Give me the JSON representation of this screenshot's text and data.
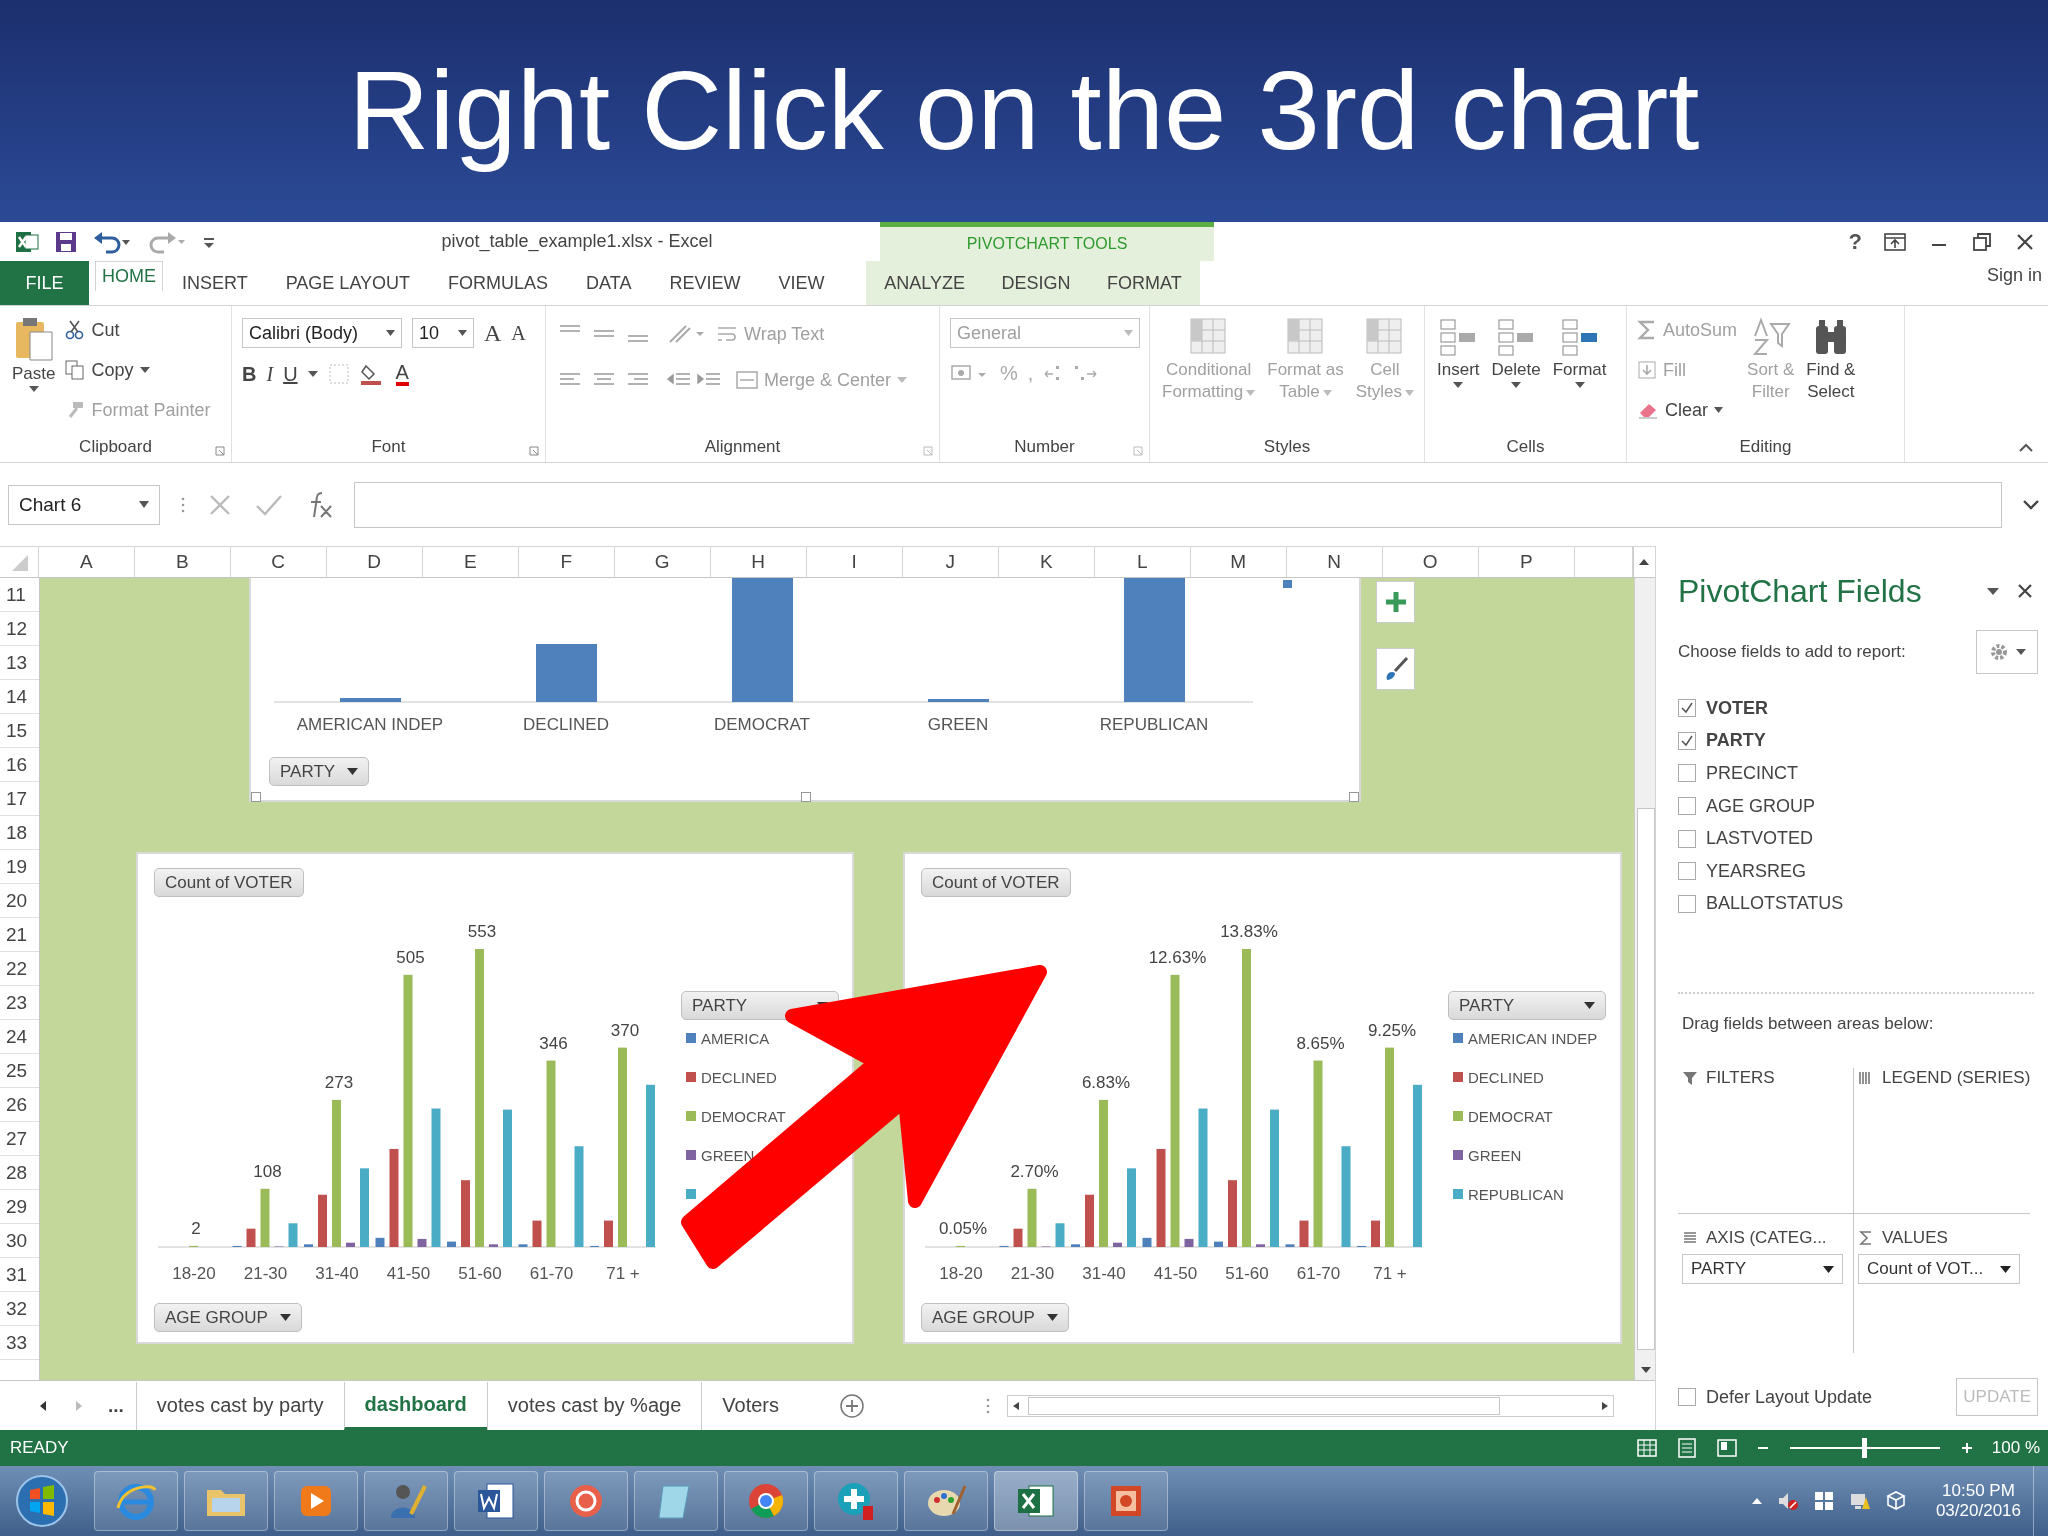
{
  "slide": {
    "title": "Right Click on the 3rd chart"
  },
  "window": {
    "title": "pivot_table_example1.xlsx - Excel",
    "context_group": "PIVOTCHART TOOLS",
    "help": "?"
  },
  "tabs": [
    {
      "label": "FILE",
      "kind": "file",
      "selected": false
    },
    {
      "label": "HOME",
      "kind": "main",
      "selected": true
    },
    {
      "label": "INSERT",
      "kind": "main",
      "selected": false
    },
    {
      "label": "PAGE LAYOUT",
      "kind": "main",
      "selected": false
    },
    {
      "label": "FORMULAS",
      "kind": "main",
      "selected": false
    },
    {
      "label": "DATA",
      "kind": "main",
      "selected": false
    },
    {
      "label": "REVIEW",
      "kind": "main",
      "selected": false
    },
    {
      "label": "VIEW",
      "kind": "main",
      "selected": false
    },
    {
      "label": "ANALYZE",
      "kind": "context",
      "selected": false
    },
    {
      "label": "DESIGN",
      "kind": "context",
      "selected": false
    },
    {
      "label": "FORMAT",
      "kind": "context",
      "selected": false
    }
  ],
  "sign_in": "Sign in",
  "ribbon": {
    "clipboard": {
      "label": "Clipboard",
      "paste": {
        "text": "Paste",
        "disabled": false
      },
      "cut": {
        "text": "Cut",
        "disabled": false
      },
      "copy": {
        "text": "Copy",
        "disabled": false
      },
      "format_painter": {
        "text": "Format Painter",
        "disabled": true
      }
    },
    "font": {
      "label": "Font",
      "font_name": "Calibri (Body)",
      "font_size": "10",
      "grow": "A",
      "shrink": "A",
      "bold": "B",
      "italic": "I",
      "underline": "U",
      "font_color": "A"
    },
    "alignment": {
      "label": "Alignment",
      "wrap_text": {
        "text": "Wrap Text",
        "disabled": true
      },
      "merge_center": {
        "text": "Merge & Center",
        "disabled": true
      }
    },
    "number": {
      "label": "Number",
      "format": {
        "text": "General",
        "disabled": true
      },
      "percent": "%",
      "comma": ","
    },
    "styles": {
      "label": "Styles",
      "buttons": [
        {
          "lines": [
            "Conditional",
            "Formatting"
          ],
          "disabled": true
        },
        {
          "lines": [
            "Format as",
            "Table"
          ],
          "disabled": true
        },
        {
          "lines": [
            "Cell",
            "Styles"
          ],
          "disabled": true
        }
      ]
    },
    "cells": {
      "label": "Cells",
      "buttons": [
        {
          "lines": [
            "Insert"
          ],
          "disabled": false
        },
        {
          "lines": [
            "Delete"
          ],
          "disabled": false
        },
        {
          "lines": [
            "Format"
          ],
          "disabled": false
        }
      ]
    },
    "editing": {
      "label": "Editing",
      "autosum": {
        "text": "AutoSum",
        "disabled": true
      },
      "fill": {
        "text": "Fill",
        "disabled": true
      },
      "clear": {
        "text": "Clear",
        "disabled": false
      },
      "sort_filter": {
        "lines": [
          "Sort &",
          "Filter"
        ],
        "disabled": true
      },
      "find_select": {
        "lines": [
          "Find &",
          "Select"
        ],
        "disabled": false
      }
    }
  },
  "formula_bar": {
    "name_box": "Chart 6"
  },
  "sheet": {
    "columns": [
      "A",
      "B",
      "C",
      "D",
      "E",
      "F",
      "G",
      "H",
      "I",
      "J",
      "K",
      "L",
      "M",
      "N",
      "O",
      "P"
    ],
    "rows": [
      "11",
      "12",
      "13",
      "14",
      "15",
      "16",
      "17",
      "18",
      "19",
      "20",
      "21",
      "22",
      "23",
      "24",
      "25",
      "26",
      "27",
      "28",
      "29",
      "30",
      "31",
      "32",
      "33"
    ],
    "charts": [
      {
        "kind": "party_total",
        "categories": [
          "AMERICAN INDEP",
          "DECLINED",
          "DEMOCRAT",
          "GREEN",
          "REPUBLICAN"
        ],
        "field_button": "PARTY"
      },
      {
        "kind": "grouped",
        "value_button": "Count of VOTER",
        "axis_button": "AGE GROUP",
        "legend_button": "PARTY",
        "categories": [
          "18-20",
          "21-30",
          "31-40",
          "41-50",
          "51-60",
          "61-70",
          "71 +"
        ],
        "value_labels": [
          "2",
          "108",
          "273",
          "505",
          "553",
          "346",
          "370"
        ],
        "legend": [
          {
            "label": "AMERICA",
            "color": "#4f81bd"
          },
          {
            "label": "DECLINED",
            "color": "#c0504d"
          },
          {
            "label": "DEMOCRAT",
            "color": "#9bbb59"
          },
          {
            "label": "GREEN",
            "color": "#8064a2"
          },
          {
            "color": "#4bacc6"
          }
        ]
      },
      {
        "kind": "grouped",
        "value_button": "Count of VOTER",
        "axis_button": "AGE GROUP",
        "legend_button": "PARTY",
        "categories": [
          "18-20",
          "21-30",
          "31-40",
          "41-50",
          "51-60",
          "61-70",
          "71 +"
        ],
        "value_labels": [
          "0.05%",
          "2.70%",
          "6.83%",
          "12.63%",
          "13.83%",
          "8.65%",
          "9.25%"
        ],
        "legend": [
          {
            "label": "AMERICAN INDEP",
            "color": "#4f81bd"
          },
          {
            "label": "DECLINED",
            "color": "#c0504d"
          },
          {
            "label": "DEMOCRAT",
            "color": "#9bbb59"
          },
          {
            "label": "GREEN",
            "color": "#8064a2"
          },
          {
            "label": "REPUBLICAN",
            "color": "#4bacc6"
          }
        ]
      }
    ]
  },
  "sheet_tabs": {
    "more": "...",
    "tabs": [
      {
        "label": "votes cast by party",
        "selected": false
      },
      {
        "label": "dashboard",
        "selected": true
      },
      {
        "label": "votes cast by %age",
        "selected": false
      },
      {
        "label": "Voters",
        "selected": false
      }
    ]
  },
  "pivot_pane": {
    "title": "PivotChart Fields",
    "prompt": "Choose fields to add to report:",
    "fields": [
      {
        "label": "VOTER",
        "checked": true
      },
      {
        "label": "PARTY",
        "checked": true
      },
      {
        "label": "PRECINCT",
        "checked": false
      },
      {
        "label": "AGE GROUP",
        "checked": false
      },
      {
        "label": "LASTVOTED",
        "checked": false
      },
      {
        "label": "YEARSREG",
        "checked": false
      },
      {
        "label": "BALLOTSTATUS",
        "checked": false
      }
    ],
    "drag_hint": "Drag fields between areas below:",
    "areas": [
      {
        "kind": "filters",
        "label": "FILTERS"
      },
      {
        "kind": "legend",
        "label": "LEGEND (SERIES)"
      },
      {
        "kind": "axis",
        "label": "AXIS (CATEG...",
        "item": "PARTY"
      },
      {
        "kind": "values",
        "label": "VALUES",
        "item": "Count of VOT..."
      }
    ],
    "defer": {
      "label": "Defer Layout Update",
      "checked": false
    },
    "update": {
      "label": "UPDATE",
      "disabled": true
    }
  },
  "status_bar": {
    "mode": "READY",
    "zoom_slider": {
      "level": 0.5
    },
    "zoom": "100 %"
  },
  "clock": {
    "time": "10:50 PM",
    "date": "03/20/2016"
  }
}
